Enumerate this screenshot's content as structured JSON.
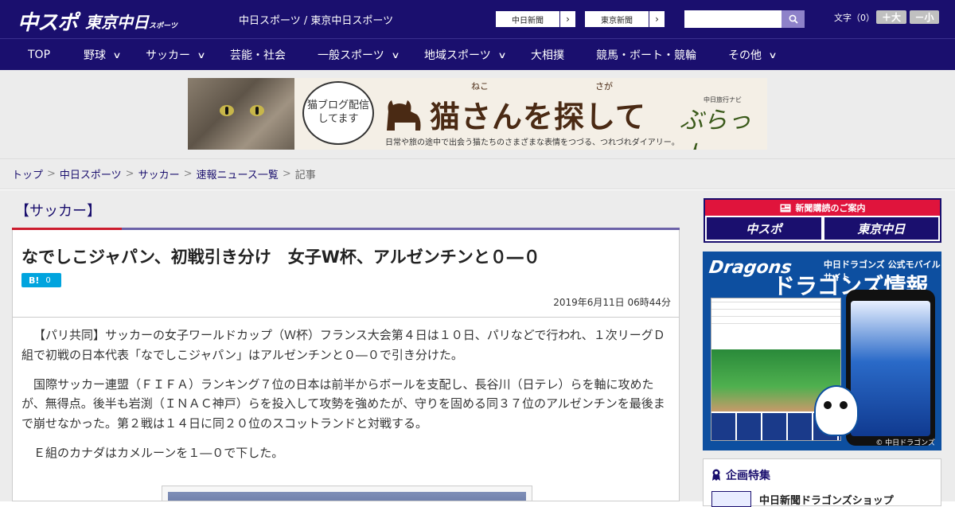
{
  "header": {
    "logo_chuspo": "中スポ",
    "logo_tokyo": "東京中日",
    "logo_tokyo_small": "スポーツ",
    "site_title": "中日スポーツ / 東京中日スポーツ",
    "paper_links": [
      {
        "label": "中日新聞"
      },
      {
        "label": "東京新聞"
      }
    ],
    "search_placeholder": "",
    "fontsize_label": "文字（0）",
    "font_larger": "＋大",
    "font_smaller": "－小"
  },
  "nav": {
    "items": [
      {
        "label": "TOP",
        "has_dropdown": false
      },
      {
        "label": "野球",
        "has_dropdown": true
      },
      {
        "label": "サッカー",
        "has_dropdown": true
      },
      {
        "label": "芸能・社会",
        "has_dropdown": false
      },
      {
        "label": "一般スポーツ",
        "has_dropdown": true
      },
      {
        "label": "地域スポーツ",
        "has_dropdown": true
      },
      {
        "label": "大相撲",
        "has_dropdown": false
      },
      {
        "label": "競馬・ボート・競輪",
        "has_dropdown": false
      },
      {
        "label": "その他",
        "has_dropdown": true
      }
    ]
  },
  "banner": {
    "bubble_text": "猫ブログ配信してます",
    "main_text": "猫さんを探して",
    "furigana_1": "ねこ",
    "furigana_2": "さが",
    "sub_text": "日常や旅の途中で出会う猫たちのさまざまな表情をつづる、つれづれダイアリー。",
    "brand_small": "中日旅行ナビ",
    "brand": "ぶらっ人"
  },
  "breadcrumb": [
    {
      "label": "トップ",
      "link": true
    },
    {
      "label": "中日スポーツ",
      "link": true
    },
    {
      "label": "サッカー",
      "link": true
    },
    {
      "label": "速報ニュース一覧",
      "link": true
    },
    {
      "label": "記事",
      "link": false
    }
  ],
  "article": {
    "category": "【サッカー】",
    "headline": "なでしこジャパン、初戦引き分け　女子W杯、アルゼンチンと０―０",
    "hatena_label": "B!",
    "hatena_count": "0",
    "date": "2019年6月11日 06時44分",
    "paragraphs": [
      "【パリ共同】サッカーの女子ワールドカップ（Ｗ杯）フランス大会第４日は１０日、パリなどで行われ、１次リーグＤ組で初戦の日本代表「なでしこジャパン」はアルゼンチンと０―０で引き分けた。",
      "国際サッカー連盟（ＦＩＦＡ）ランキング７位の日本は前半からボールを支配し、長谷川（日テレ）らを軸に攻めたが、無得点。後半も岩渕（ＩＮＡＣ神戸）らを投入して攻勢を強めたが、守りを固める同３７位のアルゼンチンを最後まで崩せなかった。第２戦は１４日に同２０位のスコットランドと対戦する。",
      "Ｅ組のカナダはカメルーンを１―０で下した。"
    ]
  },
  "sidebar": {
    "subscribe_head": "新聞購読のご案内",
    "subscribe_logos": [
      "中スポ",
      "東京中日"
    ],
    "dragons_brand": "Dragons",
    "dragons_small": "中日ドラゴンズ 公式モバイルサイト",
    "dragons_big": "ドラゴンズ情報",
    "dragons_copy": "© 中日ドラゴンズ",
    "feature_title": "企画特集",
    "feature_item": "中日新聞ドラゴンズショップ"
  },
  "colors": {
    "header_bg": "#1a0f6e",
    "accent_red": "#cc1c2e",
    "accent_purple": "#6c62a8",
    "hatena_blue": "#00a4de",
    "dragons_blue": "#0d4fa0"
  }
}
